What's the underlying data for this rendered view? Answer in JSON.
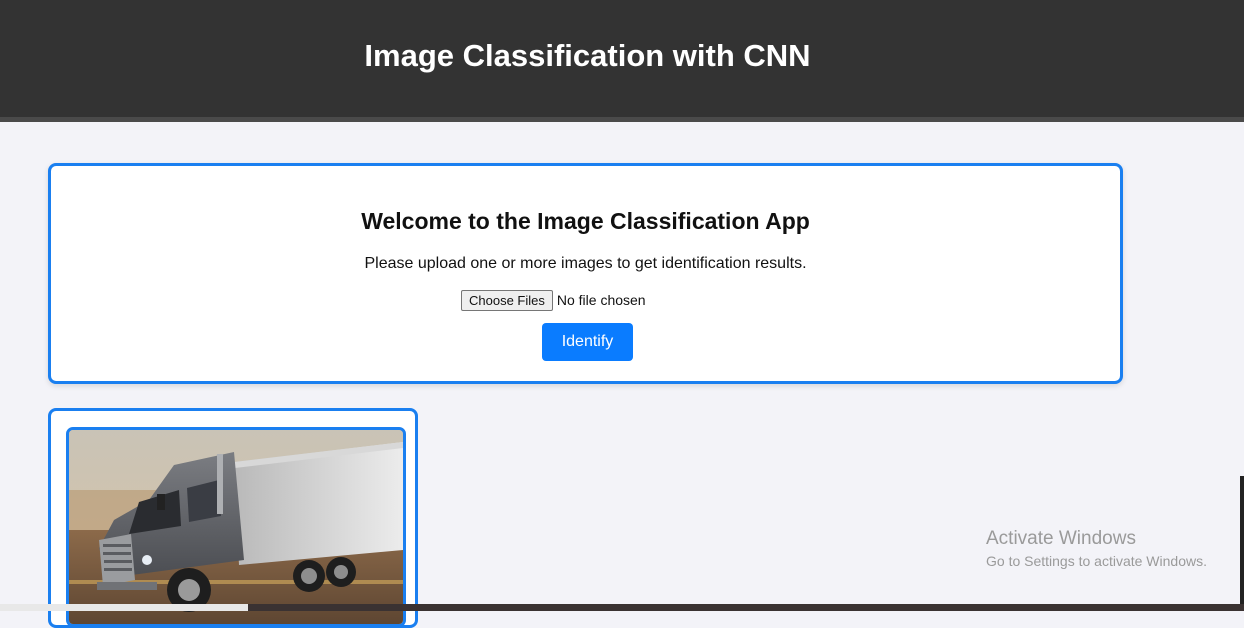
{
  "header": {
    "title": "Image Classification with CNN"
  },
  "welcome": {
    "title": "Welcome to the Image Classification App",
    "description": "Please upload one or more images to get identification results.",
    "file_input": {
      "button_label": "Choose Files",
      "status": "No file chosen"
    },
    "identify_label": "Identify"
  },
  "results": [
    {
      "image_icon": "truck-image"
    }
  ],
  "watermark": {
    "title": "Activate Windows",
    "subtitle": "Go to Settings to activate Windows."
  },
  "colors": {
    "header_bg": "#333333",
    "accent_blue": "#1a7ff0",
    "button_blue": "#0a7cff",
    "page_bg": "#f3f3f8"
  }
}
